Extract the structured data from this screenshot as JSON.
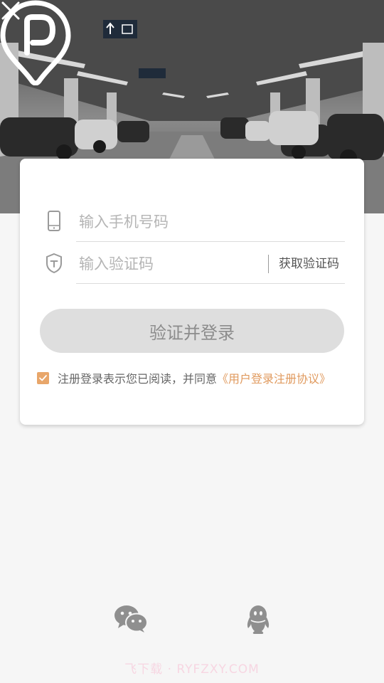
{
  "login_form": {
    "phone_placeholder": "输入手机号码",
    "code_placeholder": "输入验证码",
    "get_code_label": "获取验证码",
    "submit_label": "验证并登录",
    "agreement_text": "注册登录表示您已阅读，并同意",
    "agreement_link": "《用户登录注册协议》",
    "agreement_checked": true
  },
  "social": {
    "icons": [
      "wechat-icon",
      "qq-icon"
    ]
  },
  "watermark": "飞下载 · RYFZXY.COM",
  "colors": {
    "accent": "#e09a5e",
    "button_bg": "#dedede",
    "button_text": "#8c8c8c",
    "page_bg": "#f6f6f6"
  }
}
